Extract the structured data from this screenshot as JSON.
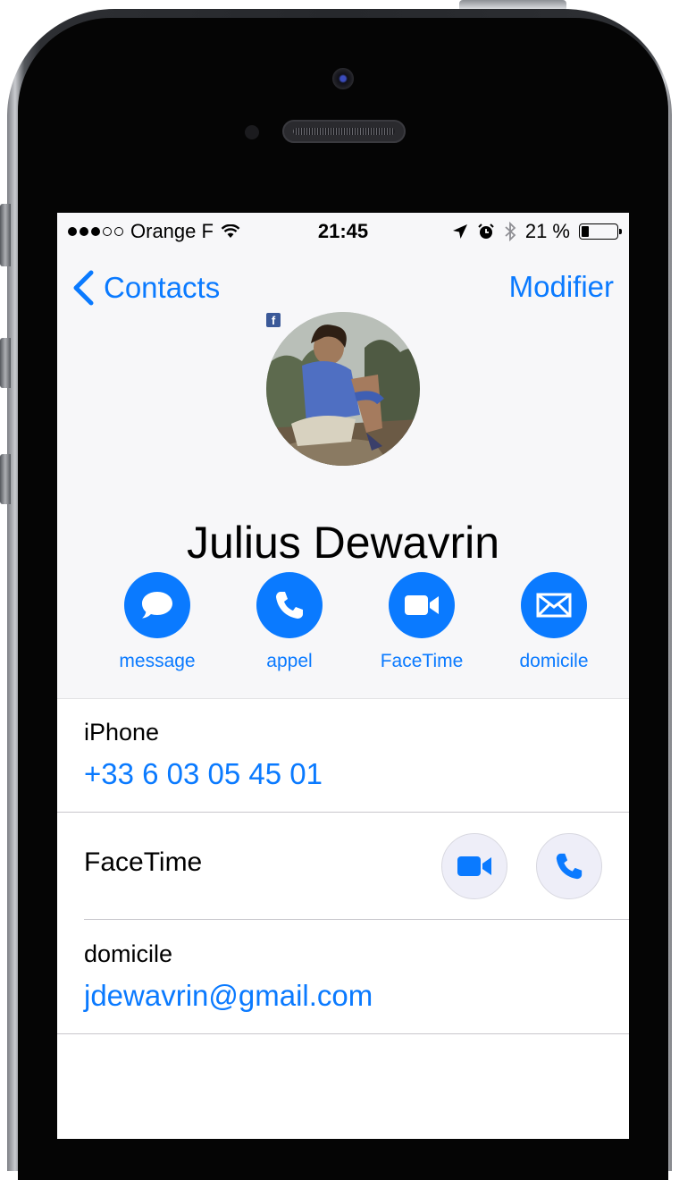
{
  "status_bar": {
    "carrier": "Orange F",
    "time": "21:45",
    "battery_percent": "21 %",
    "battery_level": 0.21,
    "signal_bars": 3,
    "signal_total": 5
  },
  "nav": {
    "back_label": "Contacts",
    "edit_label": "Modifier"
  },
  "contact": {
    "name": "Julius Dewavrin",
    "avatar_source_badge": "f"
  },
  "actions": [
    {
      "label": "message",
      "icon": "message-bubble-icon"
    },
    {
      "label": "appel",
      "icon": "phone-icon"
    },
    {
      "label": "FaceTime",
      "icon": "video-camera-icon"
    },
    {
      "label": "domicile",
      "icon": "envelope-icon"
    }
  ],
  "fields": {
    "phone": {
      "label": "iPhone",
      "value": "+33 6 03 05 45 01"
    },
    "facetime": {
      "label": "FaceTime"
    },
    "email": {
      "label": "domicile",
      "value": "jdewavrin@gmail.com"
    }
  },
  "colors": {
    "accent": "#0a7aff",
    "header_bg": "#f7f7f9"
  }
}
